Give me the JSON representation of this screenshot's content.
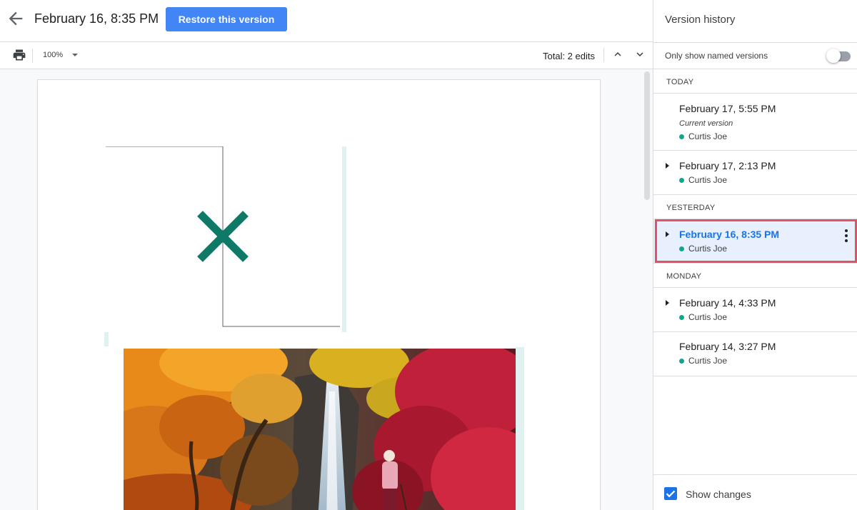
{
  "header": {
    "title": "February 16, 8:35 PM",
    "restore_label": "Restore this version"
  },
  "toolbar": {
    "zoom": "100%",
    "total_edits": "Total: 2 edits"
  },
  "icons": {
    "back": "arrow-back-icon",
    "print": "print-icon",
    "zoom_dropdown": "caret-down-icon",
    "prev_edit": "chevron-up-icon",
    "next_edit": "chevron-down-icon",
    "expand": "triangle-right-icon",
    "more": "more-vert-icon",
    "checkbox": "checkmark-icon"
  },
  "colors": {
    "accent": "#4285f4",
    "selected_text": "#1a73e8",
    "selected_bg": "#e8f0fe",
    "selection_outline": "#e05264",
    "author_dot": "#12a58b",
    "drawing_x": "#0d7966",
    "change_highlight": "#dff1f1"
  },
  "panel": {
    "title": "Version history",
    "named_only_label": "Only show named versions",
    "named_only_on": false,
    "groups": [
      {
        "label": "TODAY",
        "versions": [
          {
            "date": "February 17, 5:55 PM",
            "subtitle": "Current version",
            "author": "Curtis Joe",
            "expandable": false,
            "selected": false
          },
          {
            "date": "February 17, 2:13 PM",
            "author": "Curtis Joe",
            "expandable": true,
            "selected": false
          }
        ]
      },
      {
        "label": "YESTERDAY",
        "versions": [
          {
            "date": "February 16, 8:35 PM",
            "author": "Curtis Joe",
            "expandable": true,
            "selected": true
          }
        ]
      },
      {
        "label": "MONDAY",
        "versions": [
          {
            "date": "February 14, 4:33 PM",
            "author": "Curtis Joe",
            "expandable": true,
            "selected": false
          },
          {
            "date": "February 14, 3:27 PM",
            "author": "Curtis Joe",
            "expandable": false,
            "selected": false
          }
        ]
      }
    ],
    "show_changes_label": "Show changes",
    "show_changes_checked": true
  }
}
